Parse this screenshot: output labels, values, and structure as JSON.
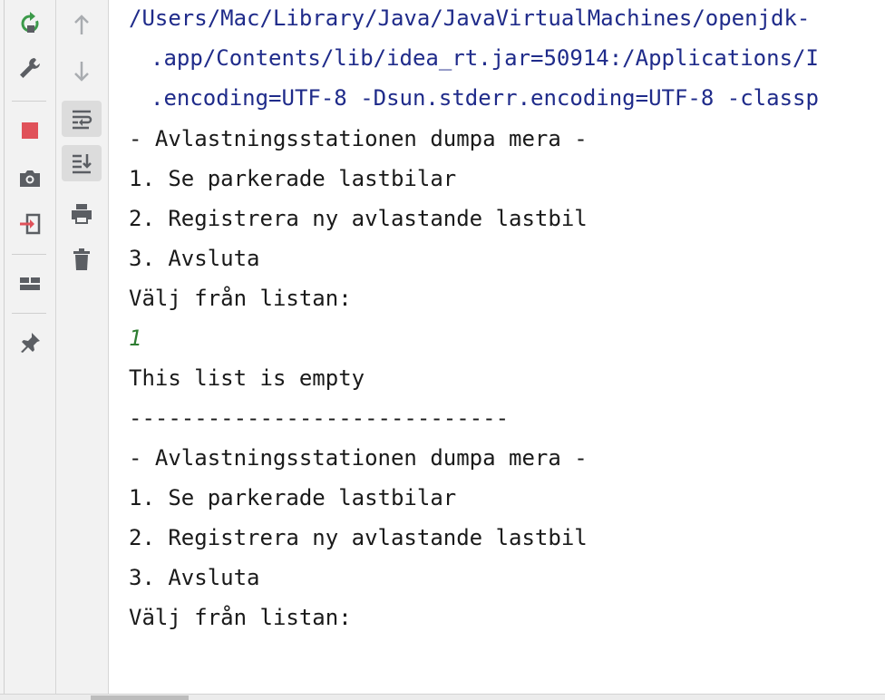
{
  "toolbar_left": {
    "items": [
      {
        "name": "rerun-icon",
        "tooltip": ""
      },
      {
        "name": "wrench-icon"
      },
      {
        "name": "stop-icon"
      },
      {
        "name": "camera-icon"
      },
      {
        "name": "exit-icon"
      },
      {
        "name": "layout-icon"
      },
      {
        "name": "pin-icon"
      }
    ]
  },
  "toolbar_right": {
    "items": [
      {
        "name": "up-arrow-icon"
      },
      {
        "name": "down-arrow-icon"
      },
      {
        "name": "soft-wrap-icon"
      },
      {
        "name": "scroll-to-end-icon"
      },
      {
        "name": "print-icon"
      },
      {
        "name": "trash-icon"
      }
    ]
  },
  "console": {
    "lines": [
      {
        "text": "/Users/Mac/Library/Java/JavaVirtualMachines/openjdk-",
        "kind": "path"
      },
      {
        "text": ".app/Contents/lib/idea_rt.jar=50914:/Applications/I",
        "kind": "path-cont"
      },
      {
        "text": ".encoding=UTF-8 -Dsun.stderr.encoding=UTF-8 -classp",
        "kind": "path-cont"
      },
      {
        "text": "- Avlastningsstationen dumpa mera -",
        "kind": "out"
      },
      {
        "text": "1. Se parkerade lastbilar",
        "kind": "out"
      },
      {
        "text": "2. Registrera ny avlastande lastbil",
        "kind": "out"
      },
      {
        "text": "3. Avsluta",
        "kind": "out"
      },
      {
        "text": "Välj från listan:",
        "kind": "out"
      },
      {
        "text": "1",
        "kind": "input"
      },
      {
        "text": "This list is empty",
        "kind": "out"
      },
      {
        "text": "-----------------------------",
        "kind": "out"
      },
      {
        "text": "- Avlastningsstationen dumpa mera -",
        "kind": "out"
      },
      {
        "text": "1. Se parkerade lastbilar",
        "kind": "out"
      },
      {
        "text": "2. Registrera ny avlastande lastbil",
        "kind": "out"
      },
      {
        "text": "3. Avsluta",
        "kind": "out"
      },
      {
        "text": "Välj från listan:",
        "kind": "out"
      }
    ]
  },
  "colors": {
    "path": "#1f2b8a",
    "input": "#2e7d32",
    "stop": "#e0525a",
    "rerun": "#3c9a4a",
    "icon": "#5b5e63"
  }
}
